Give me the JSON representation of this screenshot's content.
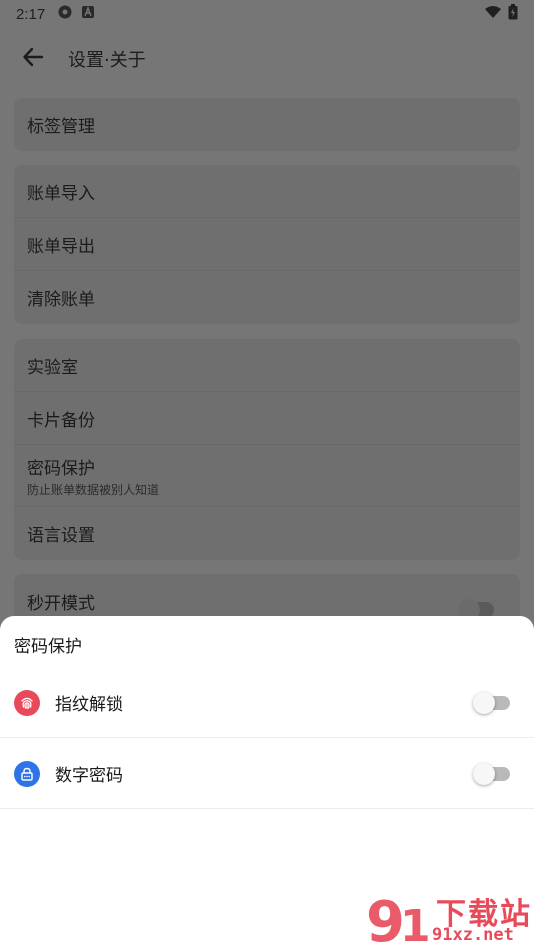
{
  "status_bar": {
    "time": "2:17",
    "left_icons": [
      "gear-icon",
      "a-icon"
    ],
    "right_icons": [
      "wifi-icon",
      "battery-icon"
    ]
  },
  "app_bar": {
    "title": "设置·关于",
    "back_icon": "arrow-left-icon"
  },
  "settings": {
    "group1": [
      {
        "label": "标签管理"
      }
    ],
    "group2": [
      {
        "label": "账单导入"
      },
      {
        "label": "账单导出"
      },
      {
        "label": "清除账单"
      }
    ],
    "group3": [
      {
        "label": "实验室"
      },
      {
        "label": "卡片备份"
      },
      {
        "label": "密码保护",
        "subtitle": "防止账单数据被别人知道"
      },
      {
        "label": "语言设置"
      }
    ],
    "group4": [
      {
        "label": "秒开模式"
      }
    ]
  },
  "sheet": {
    "title": "密码保护",
    "options": [
      {
        "label": "指纹解锁",
        "icon": "fingerprint-icon",
        "color": "#e84a5a",
        "enabled": false
      },
      {
        "label": "数字密码",
        "icon": "lock-icon",
        "color": "#2f74e6",
        "enabled": false
      }
    ]
  },
  "watermark": {
    "top": "下载站",
    "bottom": "91xz.net",
    "color": "#e84a5a"
  }
}
